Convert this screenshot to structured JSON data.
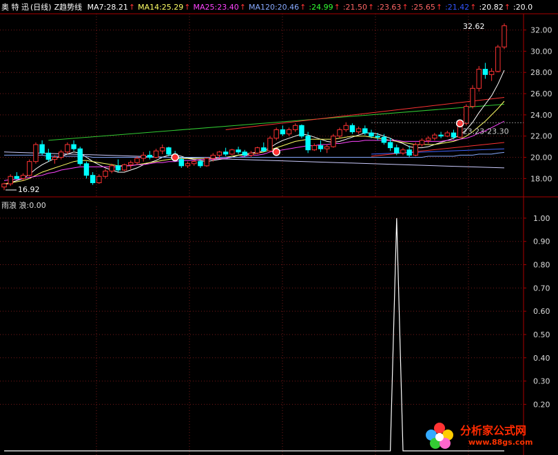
{
  "legend": {
    "stock_name": "奥 特 迅",
    "period": "(日线)",
    "indicator": "Z趋势线",
    "items": [
      {
        "text": "MA7:28.21",
        "color": "#ffffff",
        "arrow": "↑"
      },
      {
        "text": "MA14:25.29",
        "color": "#ffff66",
        "arrow": "↑"
      },
      {
        "text": "MA25:23.40",
        "color": "#ff44ff",
        "arrow": "↑"
      },
      {
        "text": "MA120:20.46",
        "color": "#88aaff",
        "arrow": "↑"
      },
      {
        "text": ":24.99",
        "color": "#33ff33",
        "arrow": "↑"
      },
      {
        "text": ":21.50",
        "color": "#ff6666",
        "arrow": "↑"
      },
      {
        "text": ":23.63",
        "color": "#ff6666",
        "arrow": "↑"
      },
      {
        "text": ":25.65",
        "color": "#ff6666",
        "arrow": "↑"
      },
      {
        "text": ":21.42",
        "color": "#3355ff",
        "arrow": "↑"
      },
      {
        "text": ":20.82",
        "color": "#ffffff",
        "arrow": "↑"
      },
      {
        "text": ":20.0",
        "color": "#ffffff",
        "arrow": ""
      }
    ]
  },
  "annotations": {
    "high": "32.62",
    "low": "16.92",
    "range": "23.23-23.30"
  },
  "indicator_legend": "雨浪  浪:0.00",
  "watermark": {
    "text": "分析家公式网",
    "url": "www.88gs.com"
  },
  "colors": {
    "up": "#ff3333",
    "down": "#00ffff",
    "grid": "#7a1a1a",
    "axis": "#aa0000"
  },
  "chart_data": [
    {
      "type": "candlestick",
      "title": "奥 特 迅 (日线)",
      "ylim": [
        16.92,
        32.62
      ],
      "y_ticks": [
        18.0,
        20.0,
        22.0,
        24.0,
        26.0,
        28.0,
        30.0,
        32.0
      ],
      "y_tick_labels": [
        "18.00",
        "20.00",
        "22.00",
        "24.00",
        "26.00",
        "28.00",
        "30.00",
        "32.00"
      ],
      "grid": true,
      "ohlc": [
        [
          17.2,
          17.6,
          16.9,
          17.5
        ],
        [
          17.5,
          18.4,
          17.3,
          18.2
        ],
        [
          18.2,
          18.6,
          17.9,
          18.0
        ],
        [
          18.0,
          18.5,
          17.8,
          18.3
        ],
        [
          18.3,
          19.8,
          18.2,
          19.6
        ],
        [
          19.6,
          21.4,
          19.4,
          21.2
        ],
        [
          21.2,
          21.6,
          20.2,
          20.4
        ],
        [
          20.4,
          20.8,
          19.6,
          19.8
        ],
        [
          19.8,
          20.2,
          19.4,
          20.0
        ],
        [
          20.0,
          20.7,
          19.8,
          20.5
        ],
        [
          20.5,
          21.4,
          20.3,
          21.2
        ],
        [
          21.2,
          21.6,
          20.6,
          20.8
        ],
        [
          20.8,
          21.0,
          19.2,
          19.4
        ],
        [
          19.4,
          19.6,
          18.0,
          18.3
        ],
        [
          18.3,
          18.6,
          17.4,
          17.6
        ],
        [
          17.6,
          18.4,
          17.5,
          18.2
        ],
        [
          18.2,
          18.9,
          18.0,
          18.7
        ],
        [
          18.7,
          19.4,
          18.5,
          19.2
        ],
        [
          19.2,
          19.8,
          18.6,
          18.8
        ],
        [
          18.8,
          19.4,
          18.7,
          19.3
        ],
        [
          19.3,
          19.7,
          18.9,
          19.5
        ],
        [
          19.5,
          20.1,
          19.3,
          19.9
        ],
        [
          19.9,
          20.5,
          19.6,
          20.2
        ],
        [
          20.2,
          20.6,
          19.8,
          20.0
        ],
        [
          20.0,
          20.8,
          19.9,
          20.6
        ],
        [
          20.6,
          21.2,
          20.3,
          20.9
        ],
        [
          20.9,
          21.0,
          20.1,
          20.3
        ],
        [
          20.3,
          20.6,
          19.6,
          19.8
        ],
        [
          19.8,
          20.0,
          19.0,
          19.2
        ],
        [
          19.2,
          19.6,
          19.0,
          19.4
        ],
        [
          19.4,
          19.8,
          19.2,
          19.6
        ],
        [
          19.6,
          19.8,
          19.0,
          19.2
        ],
        [
          19.2,
          20.0,
          19.1,
          19.9
        ],
        [
          19.9,
          20.4,
          19.6,
          20.2
        ],
        [
          20.2,
          20.6,
          19.9,
          20.5
        ],
        [
          20.5,
          20.9,
          20.1,
          20.3
        ],
        [
          20.3,
          20.8,
          20.2,
          20.7
        ],
        [
          20.7,
          21.0,
          20.3,
          20.5
        ],
        [
          20.5,
          20.7,
          20.0,
          20.2
        ],
        [
          20.2,
          20.6,
          20.0,
          20.4
        ],
        [
          20.4,
          21.0,
          20.3,
          20.9
        ],
        [
          20.9,
          21.4,
          20.5,
          20.6
        ],
        [
          20.6,
          22.0,
          20.5,
          21.8
        ],
        [
          21.8,
          22.8,
          21.6,
          22.6
        ],
        [
          22.6,
          23.0,
          22.0,
          22.2
        ],
        [
          22.2,
          22.8,
          22.0,
          22.6
        ],
        [
          22.6,
          23.2,
          22.4,
          23.0
        ],
        [
          23.0,
          23.1,
          21.8,
          22.0
        ],
        [
          22.0,
          22.4,
          20.4,
          20.7
        ],
        [
          20.7,
          21.3,
          20.6,
          21.1
        ],
        [
          21.1,
          21.6,
          20.5,
          20.8
        ],
        [
          20.8,
          21.2,
          20.4,
          21.0
        ],
        [
          21.0,
          22.2,
          20.9,
          22.0
        ],
        [
          22.0,
          22.8,
          21.8,
          22.6
        ],
        [
          22.6,
          23.3,
          22.4,
          23.0
        ],
        [
          23.0,
          23.2,
          22.2,
          22.4
        ],
        [
          22.4,
          22.9,
          22.2,
          22.7
        ],
        [
          22.7,
          23.0,
          22.1,
          22.3
        ],
        [
          22.3,
          22.6,
          21.8,
          22.0
        ],
        [
          22.0,
          22.3,
          21.6,
          21.9
        ],
        [
          21.9,
          22.2,
          21.2,
          21.4
        ],
        [
          21.4,
          21.8,
          20.6,
          20.9
        ],
        [
          20.9,
          21.2,
          20.2,
          20.4
        ],
        [
          20.4,
          20.9,
          20.2,
          20.7
        ],
        [
          20.7,
          21.1,
          20.0,
          20.2
        ],
        [
          20.2,
          21.4,
          20.1,
          21.2
        ],
        [
          21.2,
          21.8,
          21.0,
          21.6
        ],
        [
          21.6,
          22.0,
          21.3,
          21.8
        ],
        [
          21.8,
          22.3,
          21.6,
          22.1
        ],
        [
          22.1,
          22.4,
          21.8,
          22.0
        ],
        [
          22.0,
          22.5,
          21.9,
          22.3
        ],
        [
          22.3,
          22.6,
          21.7,
          21.9
        ],
        [
          21.9,
          23.4,
          21.8,
          23.2
        ],
        [
          23.2,
          25.0,
          23.0,
          24.8
        ],
        [
          24.8,
          26.8,
          24.6,
          26.5
        ],
        [
          26.5,
          28.6,
          26.2,
          28.3
        ],
        [
          28.3,
          28.9,
          27.4,
          27.8
        ],
        [
          27.8,
          28.4,
          27.2,
          28.1
        ],
        [
          28.1,
          30.6,
          28.0,
          30.4
        ],
        [
          30.4,
          32.62,
          30.2,
          32.4
        ]
      ],
      "series": [
        {
          "name": "MA7",
          "values": [
            17.4,
            17.6,
            17.8,
            18.0,
            18.4,
            18.9,
            19.3,
            19.6,
            19.9,
            20.1,
            20.3,
            20.5,
            20.4,
            20.0,
            19.6,
            19.3,
            19.0,
            18.8,
            18.6,
            18.6,
            18.8,
            19.0,
            19.3,
            19.5,
            19.7,
            20.0,
            20.2,
            20.2,
            20.1,
            19.9,
            19.8,
            19.7,
            19.6,
            19.7,
            19.8,
            19.9,
            20.0,
            20.2,
            20.3,
            20.4,
            20.5,
            20.6,
            20.9,
            21.3,
            21.6,
            21.8,
            22.0,
            22.2,
            22.1,
            21.9,
            21.7,
            21.5,
            21.4,
            21.5,
            21.7,
            21.9,
            22.1,
            22.3,
            22.3,
            22.2,
            22.0,
            21.8,
            21.5,
            21.3,
            21.0,
            20.9,
            20.9,
            21.0,
            21.2,
            21.4,
            21.6,
            21.8,
            22.1,
            22.6,
            23.3,
            24.2,
            25.0,
            25.8,
            26.9,
            28.21
          ]
        },
        {
          "name": "MA14",
          "values": [
            17.5,
            17.6,
            17.7,
            17.8,
            18.0,
            18.3,
            18.6,
            18.8,
            19.0,
            19.2,
            19.4,
            19.6,
            19.7,
            19.7,
            19.6,
            19.5,
            19.4,
            19.3,
            19.2,
            19.2,
            19.2,
            19.3,
            19.4,
            19.5,
            19.6,
            19.7,
            19.8,
            19.9,
            19.9,
            19.9,
            19.9,
            19.9,
            19.9,
            19.9,
            20.0,
            20.0,
            20.1,
            20.2,
            20.2,
            20.3,
            20.4,
            20.5,
            20.7,
            20.9,
            21.1,
            21.3,
            21.5,
            21.6,
            21.7,
            21.7,
            21.7,
            21.7,
            21.7,
            21.8,
            21.9,
            22.0,
            22.0,
            22.0,
            21.9,
            21.8,
            21.7,
            21.6,
            21.5,
            21.4,
            21.3,
            21.2,
            21.2,
            21.2,
            21.2,
            21.3,
            21.4,
            21.5,
            21.7,
            22.0,
            22.4,
            22.9,
            23.4,
            24.0,
            24.6,
            25.29
          ]
        },
        {
          "name": "MA25",
          "values": [
            17.8,
            17.9,
            17.9,
            18.0,
            18.1,
            18.2,
            18.3,
            18.5,
            18.6,
            18.8,
            18.9,
            19.0,
            19.1,
            19.1,
            19.1,
            19.1,
            19.1,
            19.1,
            19.1,
            19.2,
            19.2,
            19.3,
            19.3,
            19.4,
            19.5,
            19.5,
            19.6,
            19.6,
            19.7,
            19.7,
            19.7,
            19.8,
            19.8,
            19.8,
            19.9,
            19.9,
            20.0,
            20.0,
            20.1,
            20.2,
            20.2,
            20.3,
            20.5,
            20.6,
            20.7,
            20.8,
            20.9,
            21.0,
            21.1,
            21.1,
            21.2,
            21.2,
            21.3,
            21.3,
            21.4,
            21.5,
            21.5,
            21.6,
            21.6,
            21.6,
            21.6,
            21.6,
            21.6,
            21.5,
            21.5,
            21.5,
            21.5,
            21.5,
            21.5,
            21.5,
            21.6,
            21.6,
            21.7,
            21.8,
            22.0,
            22.3,
            22.5,
            22.8,
            23.1,
            23.4
          ]
        },
        {
          "name": "MA120",
          "values": [
            20.2,
            20.2,
            20.2,
            20.2,
            20.2,
            20.2,
            20.2,
            20.1,
            20.1,
            20.1,
            20.1,
            20.1,
            20.1,
            20.1,
            20.0,
            20.0,
            20.0,
            20.0,
            20.0,
            20.0,
            20.0,
            20.0,
            20.0,
            20.0,
            20.0,
            20.0,
            20.0,
            20.0,
            20.0,
            20.0,
            20.0,
            20.0,
            20.0,
            20.0,
            20.0,
            20.0,
            20.0,
            20.0,
            20.0,
            20.0,
            20.0,
            20.0,
            20.0,
            20.0,
            20.0,
            20.0,
            20.0,
            20.0,
            20.0,
            20.0,
            20.0,
            20.0,
            20.0,
            20.0,
            20.0,
            20.0,
            20.0,
            20.0,
            20.0,
            20.0,
            20.0,
            20.0,
            20.0,
            20.0,
            20.0,
            20.0,
            20.0,
            20.1,
            20.1,
            20.1,
            20.1,
            20.1,
            20.2,
            20.2,
            20.2,
            20.3,
            20.3,
            20.3,
            20.4,
            20.46
          ]
        }
      ]
    },
    {
      "type": "line",
      "title": "雨浪",
      "ylim": [
        0.0,
        1.05
      ],
      "y_ticks": [
        0.2,
        0.3,
        0.4,
        0.5,
        0.6,
        0.7,
        0.8,
        0.9,
        1.0
      ],
      "y_tick_labels": [
        "0.20",
        "0.30",
        "0.40",
        "0.50",
        "0.60",
        "0.70",
        "0.80",
        "0.90",
        "1.00"
      ],
      "grid": true,
      "series": [
        {
          "name": "浪",
          "values": [
            0,
            0,
            0,
            0,
            0,
            0,
            0,
            0,
            0,
            0,
            0,
            0,
            0,
            0,
            0,
            0,
            0,
            0,
            0,
            0,
            0,
            0,
            0,
            0,
            0,
            0,
            0,
            0,
            0,
            0,
            0,
            0,
            0,
            0,
            0,
            0,
            0,
            0,
            0,
            0,
            0,
            0,
            0,
            0,
            0,
            0,
            0,
            0,
            0,
            0,
            0,
            0,
            0,
            0,
            0,
            0,
            0,
            0,
            0,
            0,
            0,
            0,
            1,
            0,
            0,
            0,
            0,
            0,
            0,
            0,
            0,
            0,
            0,
            0,
            0,
            0,
            0,
            0,
            0,
            0
          ]
        }
      ]
    }
  ]
}
